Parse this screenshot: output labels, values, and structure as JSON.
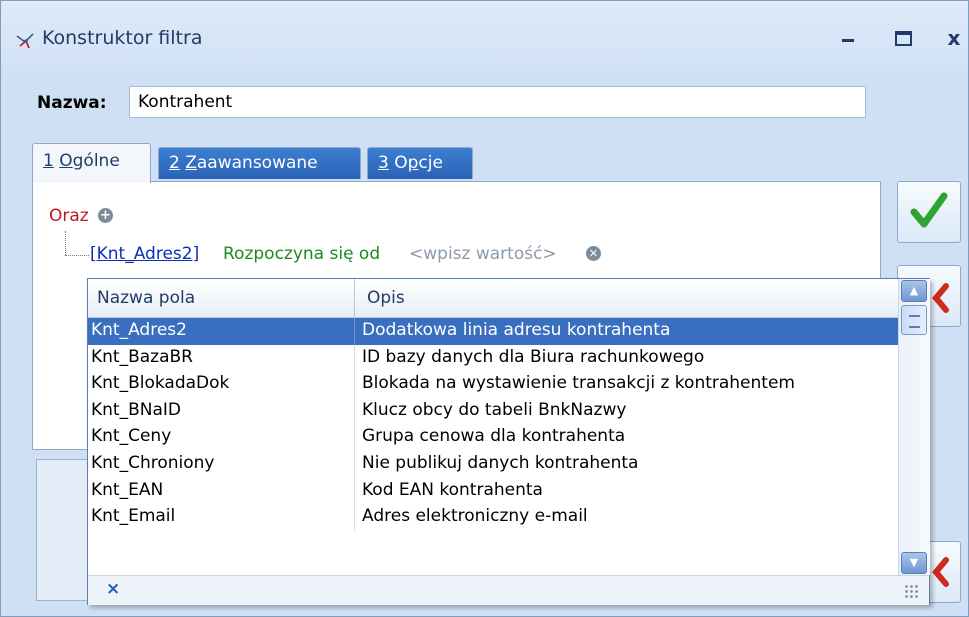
{
  "window": {
    "title": "Konstruktor filtra",
    "close_glyph": "x",
    "icon": "filter-constructor-icon"
  },
  "name": {
    "label": "Nazwa:",
    "value": "Kontrahent"
  },
  "tabs": [
    {
      "number": "1",
      "label_pre": "",
      "hotkey": "O",
      "label_post": "gólne",
      "active": true
    },
    {
      "number": "2",
      "label_pre": "",
      "hotkey": "Z",
      "label_post": "aawansowane",
      "active": false
    },
    {
      "number": "3",
      "label_pre": "O",
      "hotkey": "p",
      "label_post": "cje",
      "active": false
    }
  ],
  "filter": {
    "group_label": "Oraz",
    "condition_field": "[Knt_Adres2]",
    "condition_operator": "Rozpoczyna się od",
    "condition_value_placeholder": "<wpisz wartość>"
  },
  "field_list": {
    "columns": [
      "Nazwa pola",
      "Opis"
    ],
    "rows": [
      {
        "name": "Knt_Adres2",
        "desc": "Dodatkowa linia adresu kontrahenta",
        "selected": true
      },
      {
        "name": "Knt_BazaBR",
        "desc": "ID bazy danych dla Biura rachunkowego",
        "selected": false
      },
      {
        "name": "Knt_BlokadaDok",
        "desc": "Blokada na wystawienie transakcji z kontrahentem",
        "selected": false
      },
      {
        "name": "Knt_BNaID",
        "desc": "Klucz obcy do tabeli BnkNazwy",
        "selected": false
      },
      {
        "name": "Knt_Ceny",
        "desc": "Grupa cenowa dla kontrahenta",
        "selected": false
      },
      {
        "name": "Knt_Chroniony",
        "desc": "Nie publikuj danych kontrahenta",
        "selected": false
      },
      {
        "name": "Knt_EAN",
        "desc": "Kod EAN kontrahenta",
        "selected": false
      },
      {
        "name": "Knt_Email",
        "desc": "Adres elektroniczny e-mail",
        "selected": false
      }
    ],
    "clear_glyph": "×"
  },
  "colors": {
    "selection": "#3a6fc0",
    "group_label": "#c0161d",
    "field_link": "#0b2fb6",
    "operator": "#1e8a1e",
    "placeholder": "#8a9aa9",
    "ok_check": "#2fa32f",
    "cancel_x": "#d02a1c"
  }
}
